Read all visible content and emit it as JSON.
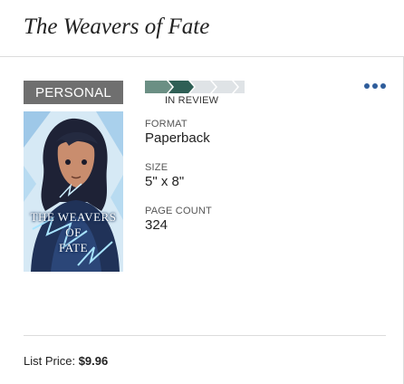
{
  "book": {
    "title": "The Weavers of Fate",
    "badge": "PERSONAL",
    "cover_title_lines": [
      "THE WEAVERS",
      "OF",
      "FATE"
    ],
    "status": "IN REVIEW",
    "status_progress_steps_complete": 2,
    "status_progress_steps_total": 5,
    "format_label": "FORMAT",
    "format_value": "Paperback",
    "size_label": "SIZE",
    "size_value": "5\" x 8\"",
    "page_count_label": "PAGE COUNT",
    "page_count_value": "324",
    "list_price_label": "List Price:",
    "list_price_value": "$9.96"
  },
  "colors": {
    "badge_bg": "#6f6f6f",
    "progress_done_1": "#6b8f84",
    "progress_done_2": "#2f5f55",
    "progress_pending": "#dfe3e6",
    "more_icon": "#2f5d9b"
  },
  "icons": {
    "more": "more-horizontal-icon"
  }
}
